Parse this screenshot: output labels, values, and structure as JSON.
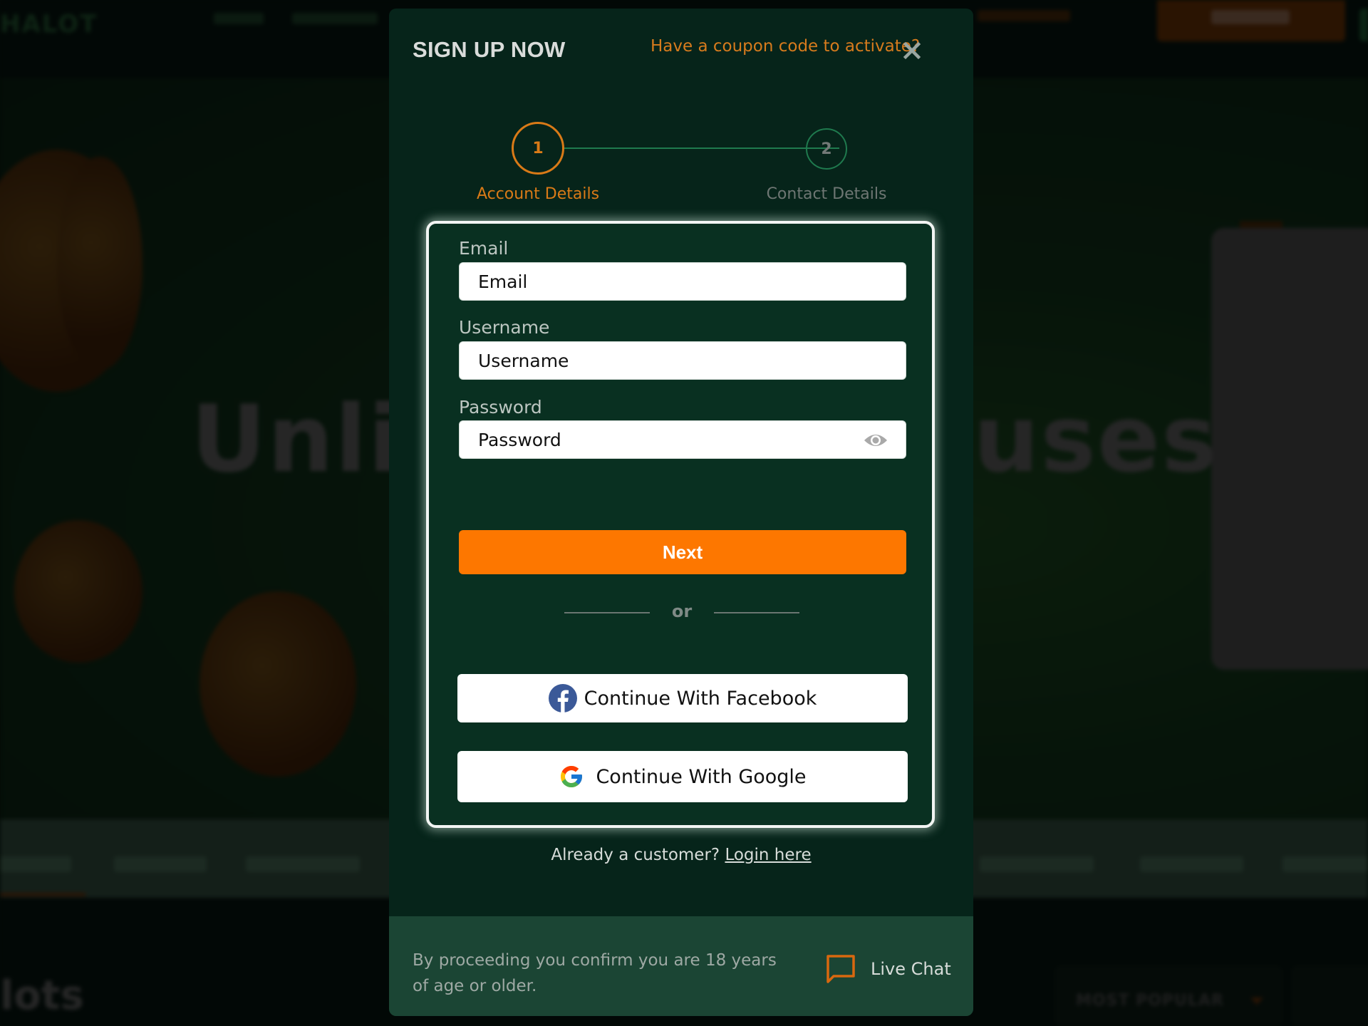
{
  "background": {
    "hero_text_left": "Unli",
    "hero_text_right": "uses",
    "section_title": "lots",
    "sort_dropdown": "MOST POPULAR"
  },
  "modal": {
    "title": "SIGN UP NOW",
    "coupon_link": "Have a coupon code to activate?",
    "close_icon": "close-icon",
    "stepper": {
      "current_step": 1,
      "steps": [
        {
          "number": "1",
          "label": "Account Details",
          "state": "active"
        },
        {
          "number": "2",
          "label": "Contact Details",
          "state": "inactive"
        }
      ]
    },
    "form": {
      "email": {
        "label": "Email",
        "placeholder": "Email",
        "value": ""
      },
      "username": {
        "label": "Username",
        "placeholder": "Username",
        "value": ""
      },
      "password": {
        "label": "Password",
        "placeholder": "Password",
        "value": "",
        "toggle_icon": "eye-icon"
      },
      "next_button": "Next",
      "divider_text": "or",
      "facebook_button": "Continue With Facebook",
      "google_button": "Continue With Google"
    },
    "login_prompt": "Already a customer?",
    "login_link": "Login here",
    "footer": {
      "age_notice": "By proceeding you confirm you are 18 years of age or older.",
      "live_chat": "Live Chat"
    }
  },
  "colors": {
    "accent_orange": "#fd7700",
    "link_orange": "#d77b1d",
    "modal_bg": "#06241a",
    "card_bg": "#093021",
    "footer_bg": "#1b4534",
    "step_line_green": "#1f7a4e",
    "facebook_blue": "#3b5998"
  }
}
